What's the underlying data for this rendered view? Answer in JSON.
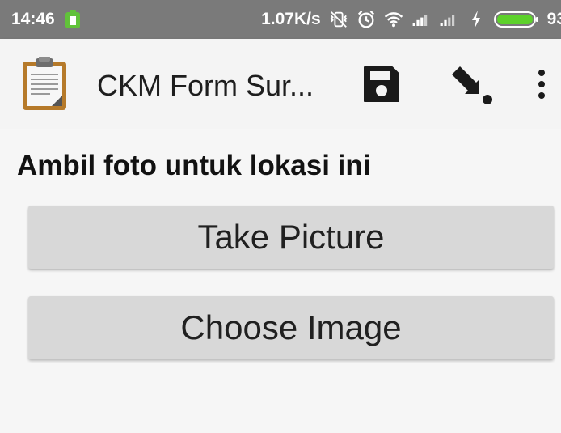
{
  "status_bar": {
    "time": "14:46",
    "network_speed": "1.07K/s",
    "battery_percent": "93",
    "icons": [
      "battery-saver-icon",
      "vibrate-off-icon",
      "alarm-icon",
      "wifi-icon",
      "signal-icon",
      "signal-icon-2",
      "charging-icon",
      "battery-icon"
    ]
  },
  "app_bar": {
    "title": "CKM Form Sur...",
    "logo_icon": "clipboard-icon",
    "actions": [
      "save-icon",
      "jump-icon",
      "overflow-menu-icon"
    ]
  },
  "question": {
    "label": "Ambil foto untuk lokasi ini"
  },
  "buttons": {
    "take_picture": "Take Picture",
    "choose_image": "Choose Image"
  },
  "colors": {
    "status_bar": "#7a7a7a",
    "app_bar": "#f4f4f4",
    "button": "#d8d8d8",
    "battery": "#5dd12b"
  }
}
